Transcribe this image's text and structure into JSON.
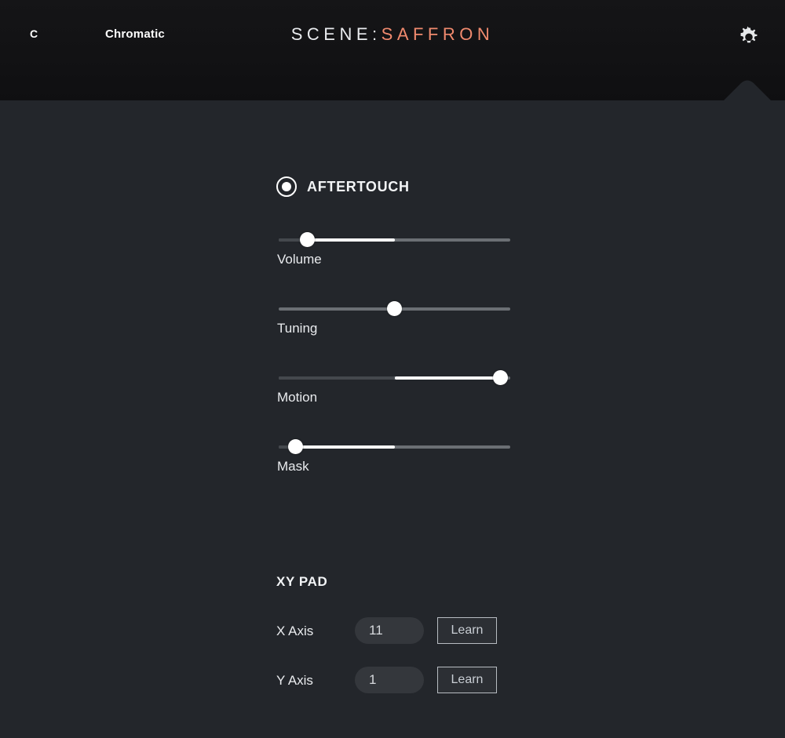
{
  "header": {
    "key_label": "C",
    "scale_label": "Chromatic",
    "title_prefix": "SCENE",
    "title_separator": ":",
    "title_scene": "SAFFRON",
    "settings_icon": "gear-icon",
    "colors": {
      "background": "#131314",
      "title_prefix_color": "#e9ebee",
      "title_scene_color": "#f08a6e"
    }
  },
  "panel": {
    "background": "#23262b",
    "aftertouch": {
      "title": "AFTERTOUCH",
      "radio_selected": true,
      "sliders": [
        {
          "label": "Volume",
          "thumb_pct": 13.2,
          "fill_start_pct": 13.2,
          "fill_end_pct": 50.2,
          "dark_lead_pct": 13.2
        },
        {
          "label": "Tuning",
          "thumb_pct": 50.2,
          "fill_start_pct": 0,
          "fill_end_pct": 0,
          "dark_lead_pct": 0
        },
        {
          "label": "Motion",
          "thumb_pct": 95.3,
          "fill_start_pct": 50.2,
          "fill_end_pct": 95.3,
          "dark_lead_pct": 50.2
        },
        {
          "label": "Mask",
          "thumb_pct": 8.1,
          "fill_start_pct": 8.1,
          "fill_end_pct": 50.2,
          "dark_lead_pct": 8.1
        }
      ]
    },
    "xypad": {
      "title": "XY PAD",
      "axes": [
        {
          "label": "X Axis",
          "value": "11",
          "placeholder": "CC",
          "learn_label": "Learn"
        },
        {
          "label": "Y Axis",
          "value": "1",
          "placeholder": "CC",
          "learn_label": "Learn"
        }
      ]
    }
  }
}
